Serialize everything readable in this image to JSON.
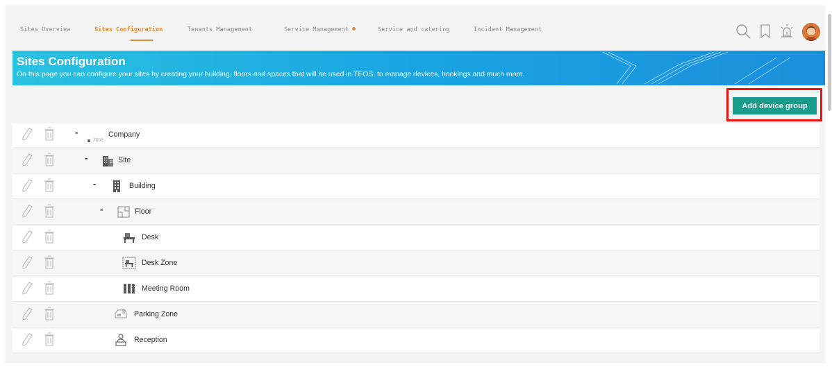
{
  "nav": {
    "tabs": [
      {
        "label": "Sites Overview"
      },
      {
        "label": "Sites Configuration"
      },
      {
        "label": "Tenants Management"
      },
      {
        "label": "Service Management"
      },
      {
        "label": "Service and catering"
      },
      {
        "label": "Incident Management"
      }
    ],
    "active_tab": "Sites Configuration",
    "icons": [
      "search-icon",
      "bookmark-icon",
      "alarm-icon",
      "avatar"
    ],
    "accent_color": "#e28a3c"
  },
  "banner": {
    "title": "Sites Configuration",
    "subtitle": "On this page you can configure your sites by creating your building, floors and spaces that will be used in TEOS, to manage devices, bookings and much more.",
    "color": "#1aa7e2"
  },
  "toolbar": {
    "add_device_group_label": "Add device group",
    "button_color": "#1a9c8c",
    "highlight_color": "#ee1111"
  },
  "tree": {
    "collapse_symbol": "-",
    "company_logo_text": "TEOS",
    "nodes": [
      {
        "label": "Company",
        "icon": "company-logo-icon",
        "expanded": true
      },
      {
        "label": "Site",
        "icon": "site-buildings-icon",
        "expanded": true
      },
      {
        "label": "Building",
        "icon": "building-icon",
        "expanded": true
      },
      {
        "label": "Floor",
        "icon": "floor-plan-icon",
        "expanded": true
      },
      {
        "label": "Desk",
        "icon": "desk-icon"
      },
      {
        "label": "Desk Zone",
        "icon": "desk-zone-icon"
      },
      {
        "label": "Meeting Room",
        "icon": "meeting-room-icon"
      },
      {
        "label": "Parking Zone",
        "icon": "parking-zone-icon"
      },
      {
        "label": "Reception",
        "icon": "reception-icon"
      }
    ]
  }
}
